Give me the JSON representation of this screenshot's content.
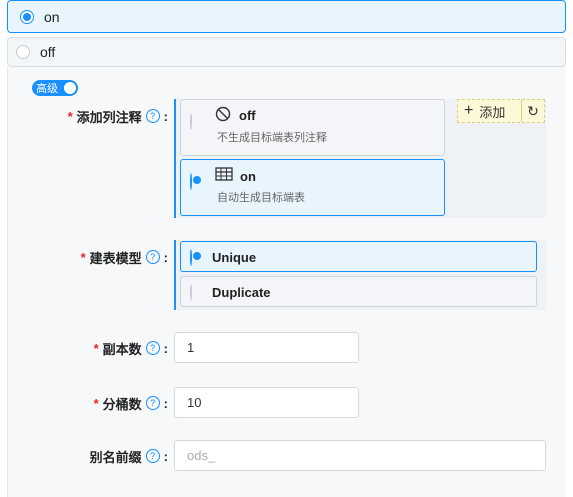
{
  "top_options": {
    "on_label": "on",
    "off_label": "off",
    "selected": "on"
  },
  "advanced": {
    "label": "高级",
    "enabled": true
  },
  "colors": {
    "accent": "#1890ff",
    "required": "#e8262d",
    "panel_bg": "#f6f8fa",
    "add_bg": "#fdf8d8"
  },
  "add_column_comment": {
    "label": "添加列注释",
    "required": true,
    "options": [
      {
        "icon": "ban-icon",
        "title": "off",
        "desc": "不生成目标端表列注释",
        "selected": false
      },
      {
        "icon": "table-icon",
        "title": "on",
        "desc": "自动生成目标端表",
        "selected": true
      }
    ],
    "add_label": "添加",
    "plus_glyph": "+",
    "refresh_glyph": "↻"
  },
  "table_model": {
    "label": "建表模型",
    "required": true,
    "options": [
      {
        "title": "Unique",
        "selected": true
      },
      {
        "title": "Duplicate",
        "selected": false
      }
    ]
  },
  "replica_count": {
    "label": "副本数",
    "required": true,
    "value": "1"
  },
  "bucket_count": {
    "label": "分桶数",
    "required": true,
    "value": "10"
  },
  "alias_prefix": {
    "label": "别名前缀",
    "required": false,
    "value": "",
    "placeholder": "ods_"
  },
  "help_glyph": "?",
  "required_mark": "*",
  "colon": ":"
}
